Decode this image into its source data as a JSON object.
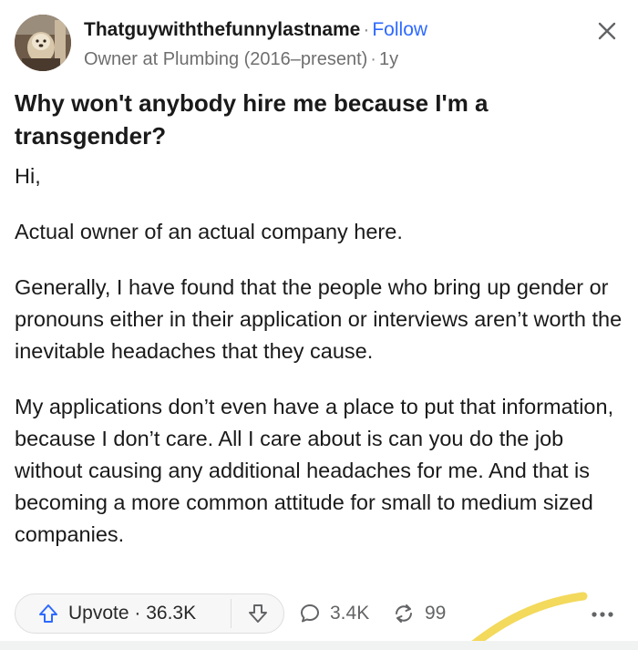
{
  "author": {
    "name": "Thatguywiththefunnylastname",
    "separator": "·",
    "follow_label": "Follow",
    "credential": "Owner at Plumbing (2016–present)",
    "time_ago": "1y"
  },
  "question": {
    "title": "Why won't anybody hire me because I'm a transgender?"
  },
  "answer": {
    "paragraphs": [
      "Hi,",
      "Actual owner of an actual company here.",
      "Generally, I have found that the people who bring up gender or pronouns either in their application or interviews aren’t worth the inevitable headaches that they cause.",
      "My applications don’t even have a place to put that information, because I don’t care. All I care about is can you do the job without causing any additional headaches for me. And that is becoming a more common attitude for small to medium sized companies."
    ]
  },
  "actions": {
    "upvote_label": "Upvote",
    "upvote_separator": "·",
    "upvote_count": "36.3K",
    "comment_count": "3.4K",
    "share_count": "99"
  },
  "icons": {
    "close": "close-icon",
    "upvote": "arrow-up-icon",
    "downvote": "arrow-down-icon",
    "comment": "comment-bubble-icon",
    "share": "share-arrows-icon",
    "more": "more-horizontal-icon"
  },
  "colors": {
    "accent": "#2e69ff",
    "upvote_icon": "#2e69ff",
    "text": "#1a1a1b",
    "muted": "#6f6f6f",
    "highlight": "#f2d54a"
  }
}
